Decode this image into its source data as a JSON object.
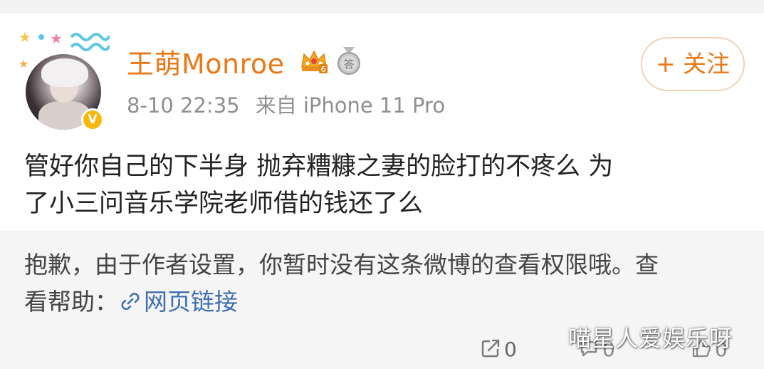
{
  "post": {
    "username": "王萌Monroe",
    "date": "8-10 22:35",
    "source": "来自 iPhone 11 Pro",
    "follow_label": "+ 关注",
    "text_line1": "管好你自己的下半身 抛弃糟糠之妻的脸打的不疼么  为",
    "text_line2": "了小三问音乐学院老师借的钱还了么",
    "crown_level": "6",
    "medal_char": "答"
  },
  "repost": {
    "notice_line1": "抱歉，由于作者设置，你暂时没有这条微博的查看权限哦。查",
    "notice_prefix": "看帮助：",
    "link_label": "网页链接"
  },
  "actions": {
    "share_count": "0",
    "comment_count": "0",
    "like_count": "0"
  },
  "watermark": "喵星人爱娱乐呀",
  "icons": {
    "verify": "verified-badge-icon",
    "crown": "crown-icon",
    "medal": "medal-icon",
    "link": "link-icon",
    "share": "share-icon",
    "comment": "comment-icon",
    "like": "like-icon"
  },
  "colors": {
    "username": "#ea7817",
    "follow_border": "#f0d4b4",
    "meta": "#8f8f8f",
    "link": "#3f6fb0",
    "verify_badge": "#f7b80d",
    "repost_bg": "#f5f5f5"
  }
}
